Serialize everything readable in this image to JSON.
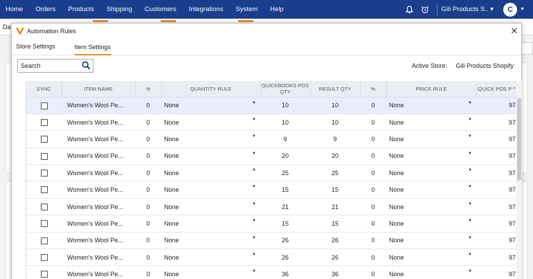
{
  "topnav": {
    "items": [
      "Home",
      "Orders",
      "Products",
      "Shipping",
      "Customers",
      "Integrations",
      "System",
      "Help"
    ],
    "store_label": "Gili Products S..",
    "avatar_initial": "C"
  },
  "background": {
    "tab_label": "Da"
  },
  "modal": {
    "title": "Automation Rules",
    "tabs": [
      {
        "label": "Store Settings",
        "active": false
      },
      {
        "label": "Item Settings",
        "active": true
      }
    ],
    "search": {
      "placeholder": "Search"
    },
    "active_store": {
      "label": "Active Store:",
      "value": "Gili Products Shopify"
    }
  },
  "table": {
    "headers": {
      "sync": "SYNC",
      "item_name": "ITEM NAME",
      "pct1": "%",
      "quantity_rule": "QUANTITY RULE",
      "qb_pos_qty": "QUICKBOOKS POS QTY",
      "result_qty": "RESULT QTY",
      "pct2": "%",
      "price_rule": "PRICE RULE",
      "qb_pos_price": "QUICK POS P"
    },
    "rows": [
      {
        "item": "Women's Wool Pe...",
        "pct": "0",
        "qty_rule": "None",
        "qb_qty": "10",
        "result": "10",
        "pct2": "0",
        "price_rule": "None",
        "qb_price": "97",
        "checked": false,
        "selected": true
      },
      {
        "item": "Women's Wool Pe...",
        "pct": "0",
        "qty_rule": "None",
        "qb_qty": "10",
        "result": "10",
        "pct2": "0",
        "price_rule": "None",
        "qb_price": "97",
        "checked": false,
        "selected": false
      },
      {
        "item": "Women's Wool Pe...",
        "pct": "0",
        "qty_rule": "None",
        "qb_qty": "9",
        "result": "9",
        "pct2": "0",
        "price_rule": "None",
        "qb_price": "97",
        "checked": false,
        "selected": false
      },
      {
        "item": "Women's Wool Pe...",
        "pct": "0",
        "qty_rule": "None",
        "qb_qty": "20",
        "result": "20",
        "pct2": "0",
        "price_rule": "None",
        "qb_price": "97",
        "checked": false,
        "selected": false
      },
      {
        "item": "Women's Wool Pe...",
        "pct": "0",
        "qty_rule": "None",
        "qb_qty": "25",
        "result": "25",
        "pct2": "0",
        "price_rule": "None",
        "qb_price": "97",
        "checked": false,
        "selected": false
      },
      {
        "item": "Women's Wool Pe...",
        "pct": "0",
        "qty_rule": "None",
        "qb_qty": "15",
        "result": "15",
        "pct2": "0",
        "price_rule": "None",
        "qb_price": "97",
        "checked": false,
        "selected": false
      },
      {
        "item": "Women's Wool Pe...",
        "pct": "0",
        "qty_rule": "None",
        "qb_qty": "21",
        "result": "21",
        "pct2": "0",
        "price_rule": "None",
        "qb_price": "97",
        "checked": false,
        "selected": false
      },
      {
        "item": "Women's Wool Pe...",
        "pct": "0",
        "qty_rule": "None",
        "qb_qty": "15",
        "result": "15",
        "pct2": "0",
        "price_rule": "None",
        "qb_price": "97",
        "checked": false,
        "selected": false
      },
      {
        "item": "Women's Wool Pe...",
        "pct": "0",
        "qty_rule": "None",
        "qb_qty": "26",
        "result": "26",
        "pct2": "0",
        "price_rule": "None",
        "qb_price": "97",
        "checked": false,
        "selected": false
      },
      {
        "item": "Women's Wool Pe...",
        "pct": "0",
        "qty_rule": "None",
        "qb_qty": "26",
        "result": "26",
        "pct2": "0",
        "price_rule": "None",
        "qb_price": "97",
        "checked": false,
        "selected": false
      },
      {
        "item": "Women's Wool Pe...",
        "pct": "0",
        "qty_rule": "None",
        "qb_qty": "36",
        "result": "36",
        "pct2": "0",
        "price_rule": "None",
        "qb_price": "97",
        "checked": false,
        "selected": false
      }
    ]
  },
  "colors": {
    "nav_bg": "#1a3e8c",
    "accent": "#f08a24",
    "header_bg": "#e9eef5",
    "selected_row": "#e8eefb"
  }
}
